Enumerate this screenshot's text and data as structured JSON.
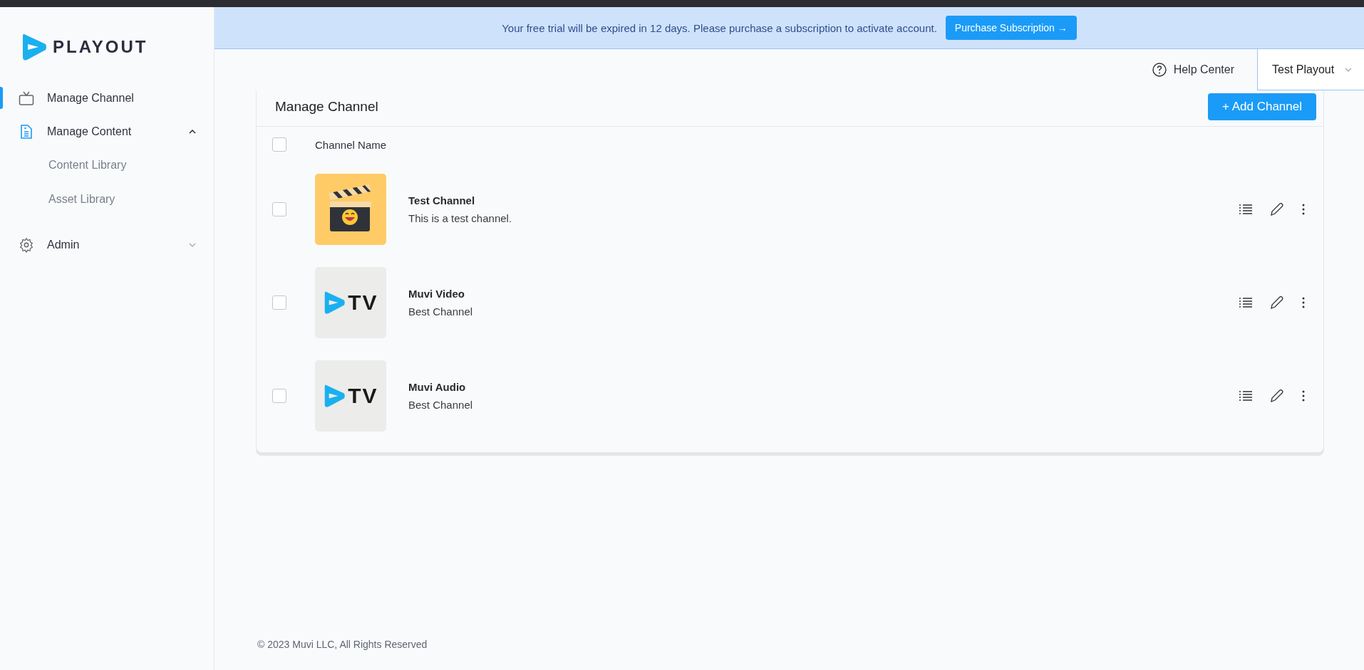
{
  "brand": {
    "name": "PLAYOUT"
  },
  "sidebar": {
    "items": [
      {
        "label": "Manage Channel",
        "kind": "tv",
        "selected": true
      },
      {
        "label": "Manage Content",
        "kind": "document",
        "selected": false,
        "expanded": true,
        "children": [
          {
            "label": "Content Library",
            "selected": false
          },
          {
            "label": "Asset Library",
            "selected": false
          }
        ]
      },
      {
        "label": "Admin",
        "kind": "gear",
        "selected": false,
        "expanded": false
      }
    ]
  },
  "banner": {
    "message": "Your free trial will be expired in 12 days. Please purchase a subscription to activate account.",
    "button": "Purchase Subscription →"
  },
  "header": {
    "help": "Help Center",
    "account": "Test Playout"
  },
  "card": {
    "title": "Manage Channel",
    "add_button": "+ Add Channel"
  },
  "table": {
    "columns": [
      "Channel Name"
    ],
    "select_all": {
      "checked": false
    },
    "rows": [
      {
        "name": "Test Channel",
        "description": "This is a test channel.",
        "checked": false,
        "kind": "clapperboard"
      },
      {
        "name": "Muvi Video",
        "description": "Best Channel",
        "checked": false,
        "kind": "logo",
        "thumbnail_text": "TV"
      },
      {
        "name": "Muvi Audio",
        "description": "Best Channel",
        "checked": false,
        "kind": "logo",
        "thumbnail_text": "TV"
      }
    ]
  },
  "footer": "© 2023 Muvi LLC, All Rights Reserved"
}
